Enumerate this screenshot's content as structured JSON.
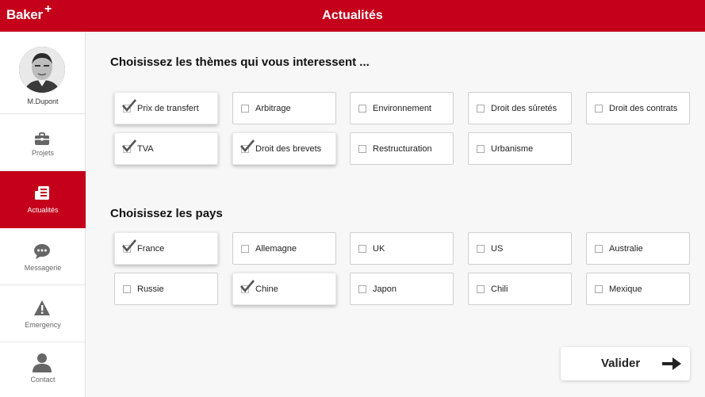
{
  "app": {
    "logo_text": "Baker",
    "logo_plus": "+",
    "title": "Actualités",
    "accent_color": "#c4001a"
  },
  "profile": {
    "username": "M.Dupont"
  },
  "sidebar": {
    "items": [
      {
        "label": "Projets",
        "icon": "briefcase-icon",
        "active": false
      },
      {
        "label": "Actualités",
        "icon": "newspaper-icon",
        "active": true
      },
      {
        "label": "Messagerie",
        "icon": "chat-bubble-icon",
        "active": false
      },
      {
        "label": "Emergency",
        "icon": "warning-icon",
        "active": false
      },
      {
        "label": "Contact",
        "icon": "person-icon",
        "active": false
      }
    ]
  },
  "themes": {
    "title": "Choisissez les thèmes qui vous interessent ...",
    "options": [
      {
        "label": "Prix de transfert",
        "checked": true
      },
      {
        "label": "Arbitrage",
        "checked": false
      },
      {
        "label": "Environnement",
        "checked": false
      },
      {
        "label": "Droit des sûretés",
        "checked": false
      },
      {
        "label": "Droit des contrats",
        "checked": false
      },
      {
        "label": "TVA",
        "checked": true
      },
      {
        "label": "Droit des brevets",
        "checked": true
      },
      {
        "label": "Restructuration",
        "checked": false
      },
      {
        "label": "Urbanisme",
        "checked": false
      }
    ]
  },
  "countries": {
    "title": "Choisissez les pays",
    "options": [
      {
        "label": "France",
        "checked": true
      },
      {
        "label": "Allemagne",
        "checked": false
      },
      {
        "label": "UK",
        "checked": false
      },
      {
        "label": "US",
        "checked": false
      },
      {
        "label": "Australie",
        "checked": false
      },
      {
        "label": "Russie",
        "checked": false
      },
      {
        "label": "Chine",
        "checked": true
      },
      {
        "label": "Japon",
        "checked": false
      },
      {
        "label": "Chili",
        "checked": false
      },
      {
        "label": "Mexique",
        "checked": false
      }
    ]
  },
  "actions": {
    "validate_label": "Valider",
    "validate_icon": "arrow-right-icon"
  }
}
